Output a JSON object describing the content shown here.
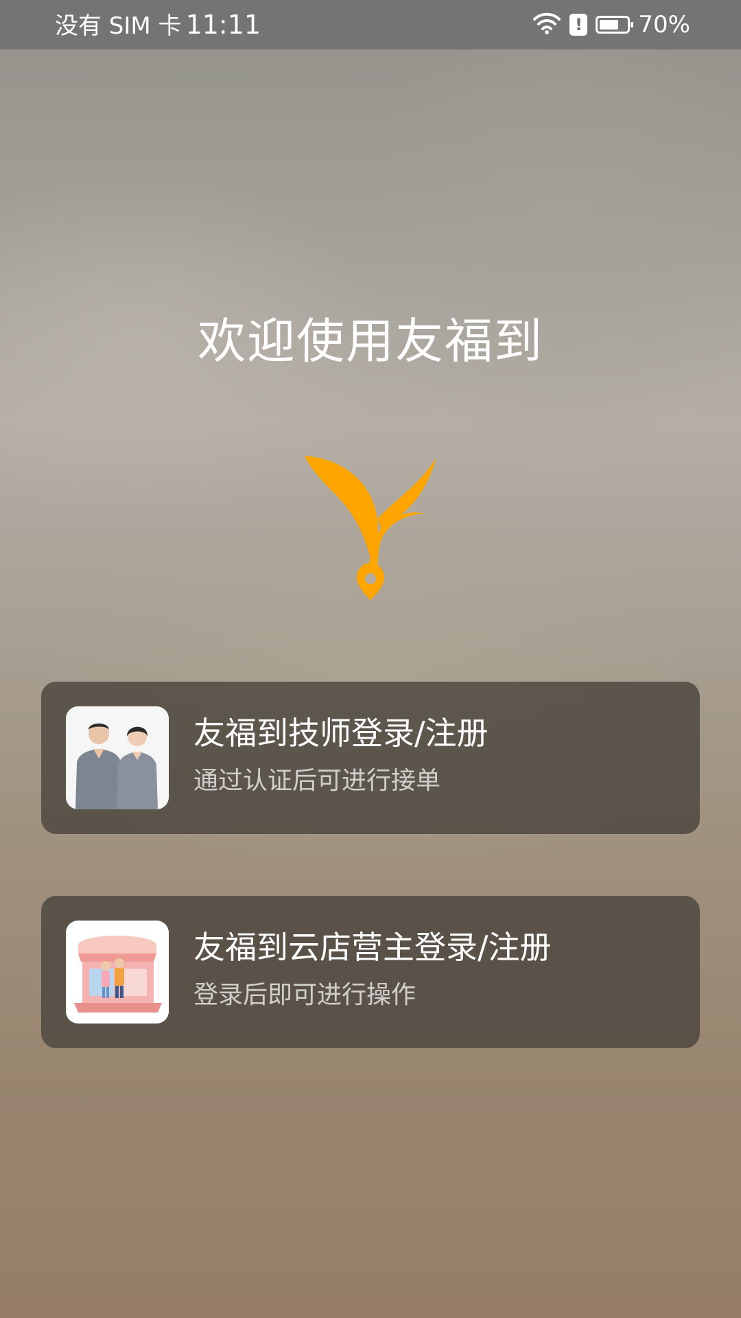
{
  "status_bar": {
    "carrier": "没有 SIM 卡",
    "time": "11:11",
    "battery": "70%",
    "battery_level": 0.7
  },
  "welcome": {
    "title": "欢迎使用友福到"
  },
  "logo": {
    "icon": "sprout-logo-icon",
    "color": "#FFA500"
  },
  "options": [
    {
      "title": "友福到技师登录/注册",
      "subtitle": "通过认证后可进行接单",
      "icon": "technician-photo"
    },
    {
      "title": "友福到云店营主登录/注册",
      "subtitle": "登录后即可进行操作",
      "icon": "store-illustration"
    }
  ]
}
